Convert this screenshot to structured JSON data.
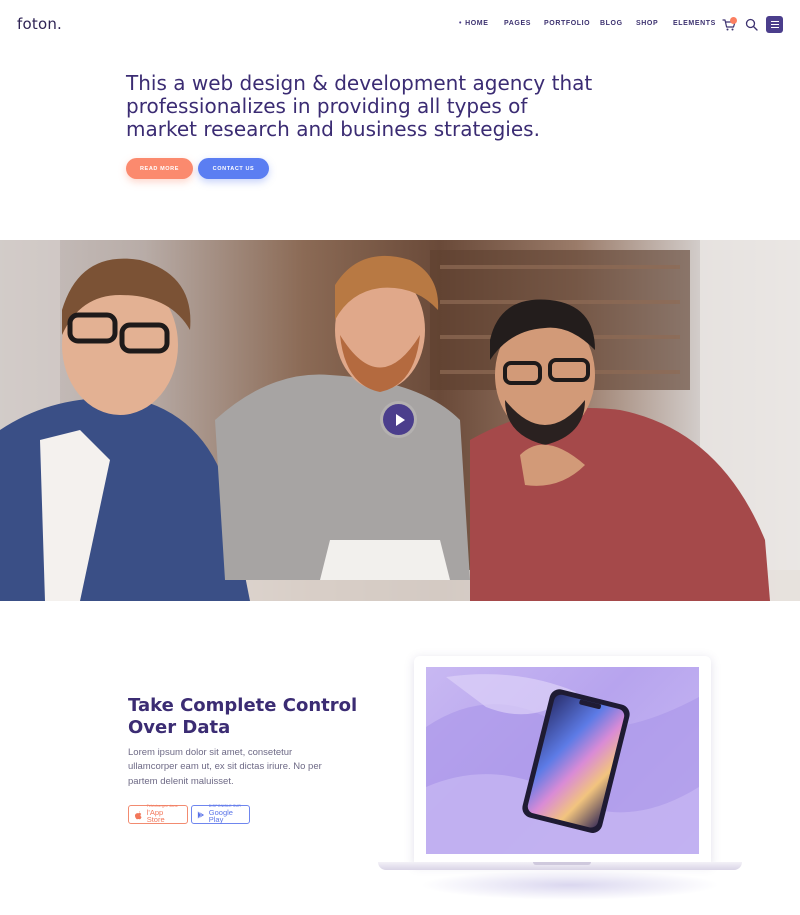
{
  "brand": {
    "logo": "foton."
  },
  "nav": {
    "items": [
      "HOME",
      "PAGES",
      "PORTFOLIO",
      "BLOG",
      "SHOP",
      "ELEMENTS"
    ],
    "active": "HOME"
  },
  "header_icons": {
    "cart": "cart-icon",
    "search": "search-icon",
    "menu": "hamburger-icon"
  },
  "hero": {
    "headline": "This a web design & development agency that professionalizes in providing all types of market research and business strategies.",
    "read_more": "READ MORE",
    "contact_us": "CONTACT US"
  },
  "photo": {
    "play_icon": "play-icon"
  },
  "feature": {
    "title": "Take Complete Control Over Data",
    "body": "Lorem ipsum dolor sit amet, consetetur ullamcorper eam ut, ex sit dictas iriure. No per partem delenit maluisset.",
    "appstore_small": "Téléchargez dans",
    "appstore_big": "l'App Store",
    "gplay_small": "DISPONIBLE SUR",
    "gplay_big": "Google Play"
  },
  "colors": {
    "primary": "#4b3e8c",
    "coral": "#fb8a6e",
    "blue": "#5b7ef2",
    "heading": "#3b2c73"
  }
}
